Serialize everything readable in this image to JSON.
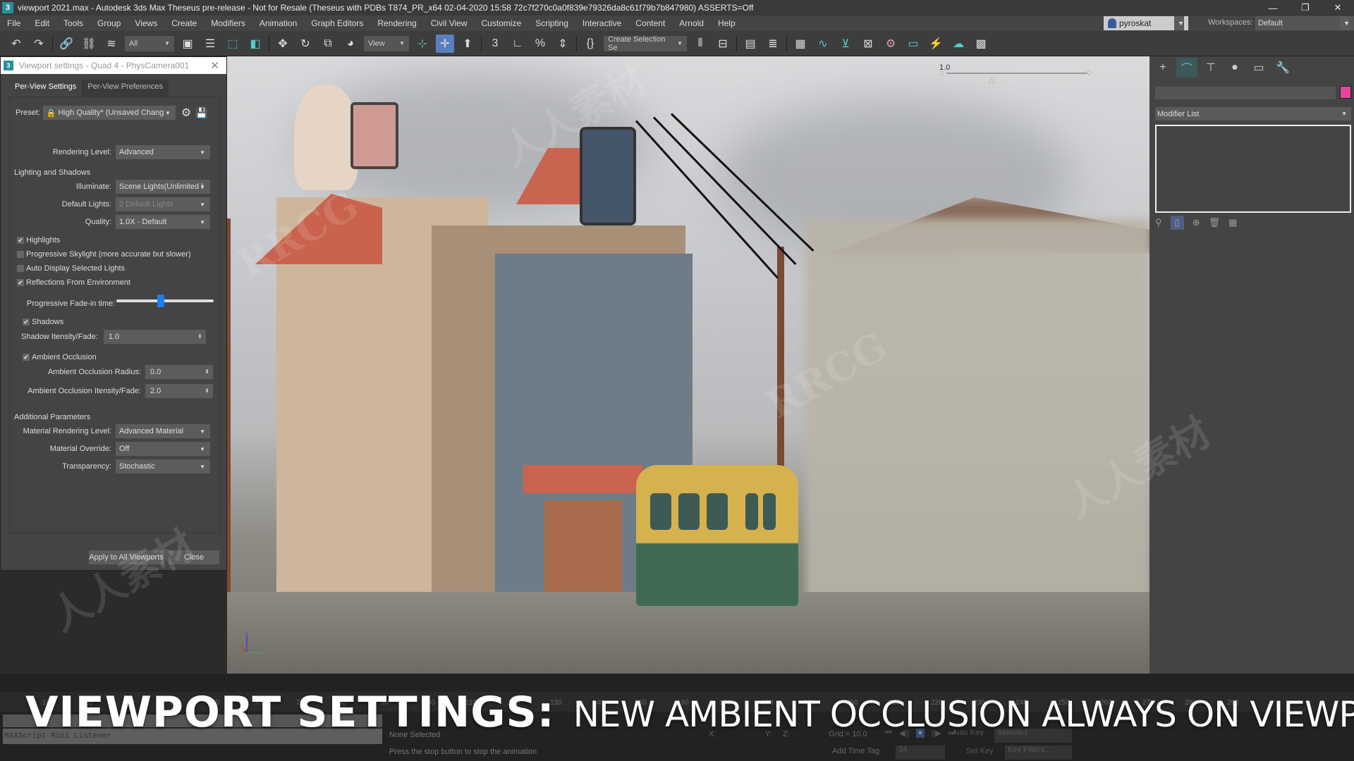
{
  "window": {
    "title": "viewport 2021.max - Autodesk 3ds Max Theseus pre-release - Not for Resale (Theseus with PDBs T874_PR_x64 02-04-2020 15:58 72c7f270c0a0f839e79326da8c61f79b7b847980) ASSERTS=Off",
    "app_icon": "3",
    "controls": {
      "minimize": "—",
      "restore": "❐",
      "close": "✕"
    }
  },
  "menubar": {
    "items": [
      "File",
      "Edit",
      "Tools",
      "Group",
      "Views",
      "Create",
      "Modifiers",
      "Animation",
      "Graph Editors",
      "Rendering",
      "Civil View",
      "Customize",
      "Scripting",
      "Interactive",
      "Content",
      "Arnold",
      "Help"
    ],
    "user": "pyroskat",
    "workspaces_label": "Workspaces:",
    "workspace": "Default"
  },
  "toolbar": {
    "selection_filter": "All",
    "reference_coord": "View",
    "named_selection": "Create Selection Se",
    "icons": {
      "undo": "↶",
      "redo": "↷",
      "link": "🔗",
      "unlink": "⛓",
      "bind": "≋",
      "select": "▣",
      "select_by_name": "☰",
      "rect_region": "⬚",
      "window_crossing": "◧",
      "move": "✥",
      "rotate": "↻",
      "scale": "⧉",
      "placement": "◕",
      "pivot": "⊹",
      "select_manipulate": "✛",
      "keyboard_shortcut": "⬆",
      "snap": "3",
      "angle_snap": "∟",
      "percent_snap": "%",
      "spinner_snap": "⇕",
      "edit_named_sel": "{}",
      "mirror": "⫴",
      "align": "⊟",
      "scene_explorer": "▤",
      "layer_explorer": "≣",
      "toggle_ribbon": "▦",
      "curve_editor": "∿",
      "schematic": "⊻",
      "material_editor": "⊠",
      "render_setup": "⚙",
      "rendered_frame": "▭",
      "render": "⚡",
      "render_cloud": "☁",
      "arnold": "▩"
    }
  },
  "dialog": {
    "title": "Viewport settings - Quad 4 - PhysCamera001",
    "tabs": [
      "Per-View Settings",
      "Per-View Preferences"
    ],
    "preset_label": "Preset:",
    "preset_value": "High Quality* (Unsaved Chang",
    "rendering_level_label": "Rendering Level:",
    "rendering_level": "Advanced",
    "lighting_section": "Lighting and Shadows",
    "illuminate_label": "Illuminate:",
    "illuminate": "Scene Lights(Unlimited l",
    "default_lights_label": "Default Lights:",
    "default_lights": "2 Default Lights",
    "quality_label": "Quality:",
    "quality": "1.0X - Default",
    "checkboxes": [
      {
        "label": "Highlights",
        "checked": true
      },
      {
        "label": "Progressive Skylight (more accurate but slower)",
        "checked": false
      },
      {
        "label": "Auto Display Selected Lights",
        "checked": false
      },
      {
        "label": "Reflections From Environment",
        "checked": true
      }
    ],
    "fade_label": "Progressive Fade-in time:",
    "fade_value_fraction": 0.45,
    "shadows_label": "Shadows",
    "shadows_checked": true,
    "shadow_intensity_label": "Shadow Itensity/Fade:",
    "shadow_intensity": "1.0",
    "ao_label": "Ambient Occlusion",
    "ao_checked": true,
    "ao_radius_label": "Ambient Occlusion Radius:",
    "ao_radius": "0.0",
    "ao_intensity_label": "Ambient Occlusion Itensity/Fade:",
    "ao_intensity": "2.0",
    "additional_section": "Additional Parameters",
    "material_level_label": "Material Rendering Level:",
    "material_level": "Advanced Material",
    "material_override_label": "Material Override:",
    "material_override": "Off",
    "transparency_label": "Transparency:",
    "transparency": "Stochastic",
    "apply_all": "Apply to All Viewports",
    "close": "Close",
    "check_glyph": "✔",
    "arrow": "▼",
    "spin_arrow": "⬍"
  },
  "viewport": {
    "time_value": "1.0",
    "axis": {
      "x": "x",
      "y": "y",
      "z": "z"
    }
  },
  "command_panel": {
    "tabs": [
      "+",
      "⌒",
      "⊤",
      "●",
      "▭",
      "🔧"
    ],
    "modifier_list": "Modifier List",
    "object_color": "#e8459a",
    "stack_buttons": [
      "⚲",
      "▯",
      "⊕",
      "🗑",
      "▦"
    ]
  },
  "bottom": {
    "timeline_ticks": [
      "10",
      "20",
      "30",
      "40",
      "50",
      "60",
      "70",
      "80",
      "90",
      "100",
      "110",
      "120",
      "130",
      "140",
      "150",
      "160",
      "170",
      "180",
      "190",
      "200",
      "210",
      "220",
      "230",
      "240",
      "250",
      "260",
      "270",
      "280",
      "290"
    ],
    "listener": "MAXScript Mini Listener",
    "none_selected": "None Selected",
    "prompt": "Press the stop button to stop the animation",
    "x_label": "X:",
    "y_label": "Y:",
    "z_label": "Z:",
    "grid": "Grid = 10.0",
    "add_time_tag": "Add Time Tag",
    "auto_key": "Auto Key",
    "selected": "Selected",
    "set_key": "Set Key",
    "key_filters": "Key Filters...",
    "frame": "34",
    "play_controls": [
      "⏮",
      "◀||",
      "⏸",
      "||▶",
      "⏭"
    ]
  },
  "caption": {
    "bold": "VIEWPORT SETTINGS:",
    "light": "NEW AMBIENT OCCLUSION ALWAYS ON VIEWPORT"
  },
  "watermarks": [
    "RRCG",
    "人人素材"
  ]
}
